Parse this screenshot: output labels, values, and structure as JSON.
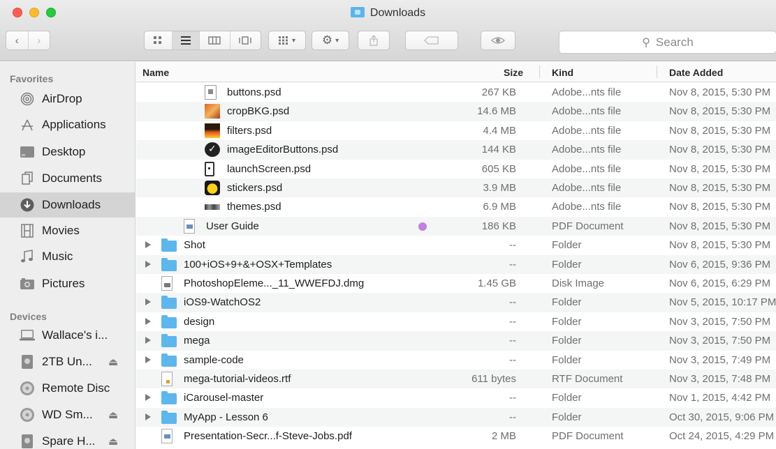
{
  "window": {
    "title": "Downloads"
  },
  "toolbar": {
    "back_icon": "chevron-left-icon",
    "forward_icon": "chevron-right-icon",
    "view_modes": [
      "icon-view-icon",
      "list-view-icon",
      "column-view-icon",
      "cover-flow-icon"
    ],
    "active_view": "list",
    "search_placeholder": "Search"
  },
  "sidebar": {
    "favorites_heading": "Favorites",
    "favorites": [
      {
        "label": "AirDrop",
        "icon": "airdrop-icon"
      },
      {
        "label": "Applications",
        "icon": "applications-icon"
      },
      {
        "label": "Desktop",
        "icon": "desktop-icon"
      },
      {
        "label": "Documents",
        "icon": "documents-icon"
      },
      {
        "label": "Downloads",
        "icon": "downloads-icon",
        "selected": true
      },
      {
        "label": "Movies",
        "icon": "movies-icon"
      },
      {
        "label": "Music",
        "icon": "music-icon"
      },
      {
        "label": "Pictures",
        "icon": "pictures-icon"
      }
    ],
    "devices_heading": "Devices",
    "devices": [
      {
        "label": "Wallace's i...",
        "icon": "laptop-icon",
        "eject": false
      },
      {
        "label": "2TB Un...",
        "icon": "drive-icon",
        "eject": true
      },
      {
        "label": "Remote Disc",
        "icon": "disc-icon",
        "eject": false
      },
      {
        "label": "WD Sm...",
        "icon": "disc-icon",
        "eject": true
      },
      {
        "label": "Spare H...",
        "icon": "drive-icon",
        "eject": true
      }
    ]
  },
  "columns": {
    "name": "Name",
    "size": "Size",
    "kind": "Kind",
    "date_added": "Date Added"
  },
  "files": [
    {
      "name": "buttons.psd",
      "size": "267 KB",
      "kind": "Adobe...nts file",
      "date": "Nov 8, 2015, 5:30 PM",
      "indent": 2,
      "icon": "psd-doc-icon"
    },
    {
      "name": "cropBKG.psd",
      "size": "14.6 MB",
      "kind": "Adobe...nts file",
      "date": "Nov 8, 2015, 5:30 PM",
      "indent": 2,
      "icon": "psd-thumb-icon"
    },
    {
      "name": "filters.psd",
      "size": "4.4 MB",
      "kind": "Adobe...nts file",
      "date": "Nov 8, 2015, 5:30 PM",
      "indent": 2,
      "icon": "psd-thumb-icon"
    },
    {
      "name": "imageEditorButtons.psd",
      "size": "144 KB",
      "kind": "Adobe...nts file",
      "date": "Nov 8, 2015, 5:30 PM",
      "indent": 2,
      "icon": "psd-badge-icon"
    },
    {
      "name": "launchScreen.psd",
      "size": "605 KB",
      "kind": "Adobe...nts file",
      "date": "Nov 8, 2015, 5:30 PM",
      "indent": 2,
      "icon": "psd-phone-icon"
    },
    {
      "name": "stickers.psd",
      "size": "3.9 MB",
      "kind": "Adobe...nts file",
      "date": "Nov 8, 2015, 5:30 PM",
      "indent": 2,
      "icon": "psd-sticker-icon"
    },
    {
      "name": "themes.psd",
      "size": "6.9 MB",
      "kind": "Adobe...nts file",
      "date": "Nov 8, 2015, 5:30 PM",
      "indent": 2,
      "icon": "psd-strip-icon"
    },
    {
      "name": "User Guide",
      "size": "186 KB",
      "kind": "PDF Document",
      "date": "Nov 8, 2015, 5:30 PM",
      "indent": 1,
      "icon": "pdf-icon",
      "tag_color": "#c27ee0"
    },
    {
      "name": "Shot",
      "size": "--",
      "kind": "Folder",
      "date": "Nov 8, 2015, 5:30 PM",
      "indent": 0,
      "icon": "folder-icon",
      "disclosure": true
    },
    {
      "name": "100+iOS+9+&+OSX+Templates",
      "size": "--",
      "kind": "Folder",
      "date": "Nov 6, 2015, 9:36 PM",
      "indent": 0,
      "icon": "folder-icon",
      "disclosure": true
    },
    {
      "name": "PhotoshopEleme..._11_WWEFDJ.dmg",
      "size": "1.45 GB",
      "kind": "Disk Image",
      "date": "Nov 6, 2015, 6:29 PM",
      "indent": 0,
      "icon": "disk-image-icon"
    },
    {
      "name": "iOS9-WatchOS2",
      "size": "--",
      "kind": "Folder",
      "date": "Nov 5, 2015, 10:17 PM",
      "indent": 0,
      "icon": "folder-icon",
      "disclosure": true
    },
    {
      "name": "design",
      "size": "--",
      "kind": "Folder",
      "date": "Nov 3, 2015, 7:50 PM",
      "indent": 0,
      "icon": "folder-icon",
      "disclosure": true
    },
    {
      "name": "mega",
      "size": "--",
      "kind": "Folder",
      "date": "Nov 3, 2015, 7:50 PM",
      "indent": 0,
      "icon": "folder-icon",
      "disclosure": true
    },
    {
      "name": "sample-code",
      "size": "--",
      "kind": "Folder",
      "date": "Nov 3, 2015, 7:49 PM",
      "indent": 0,
      "icon": "folder-icon",
      "disclosure": true
    },
    {
      "name": "mega-tutorial-videos.rtf",
      "size": "611 bytes",
      "kind": "RTF Document",
      "date": "Nov 3, 2015, 7:48 PM",
      "indent": 0,
      "icon": "rtf-icon"
    },
    {
      "name": "iCarousel-master",
      "size": "--",
      "kind": "Folder",
      "date": "Nov 1, 2015, 4:42 PM",
      "indent": 0,
      "icon": "folder-icon",
      "disclosure": true
    },
    {
      "name": "MyApp - Lesson 6",
      "size": "--",
      "kind": "Folder",
      "date": "Oct 30, 2015, 9:06 PM",
      "indent": 0,
      "icon": "folder-icon",
      "disclosure": true
    },
    {
      "name": "Presentation-Secr...f-Steve-Jobs.pdf",
      "size": "2 MB",
      "kind": "PDF Document",
      "date": "Oct 24, 2015, 4:29 PM",
      "indent": 0,
      "icon": "pdf-icon"
    }
  ]
}
